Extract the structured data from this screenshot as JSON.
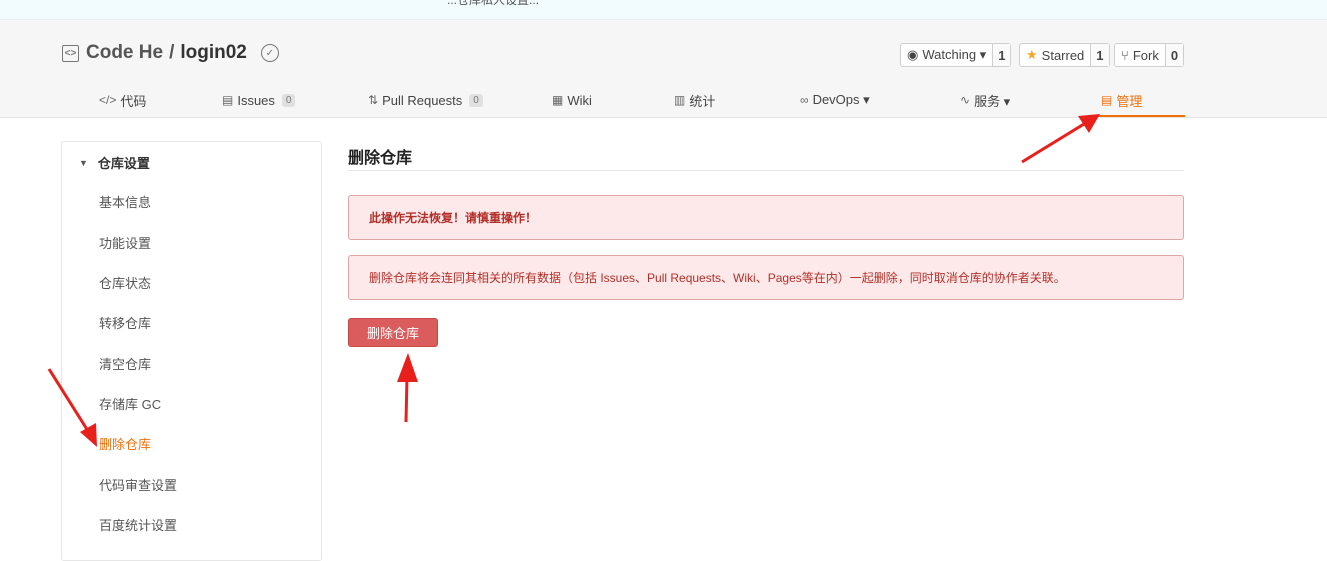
{
  "banner": {
    "text": "...仓库私人设置..."
  },
  "repo": {
    "owner": "Code He",
    "separator": "/",
    "name": "login02"
  },
  "header_actions": {
    "watch": {
      "label": "Watching ▾",
      "count": "1"
    },
    "star": {
      "label": "Starred",
      "count": "1"
    },
    "fork": {
      "label": "Fork",
      "count": "0"
    }
  },
  "tabs": [
    {
      "icon": "</>",
      "label": "代码"
    },
    {
      "icon": "▤",
      "label": "Issues",
      "count": "0"
    },
    {
      "icon": "⇅",
      "label": "Pull Requests",
      "count": "0"
    },
    {
      "icon": "▦",
      "label": "Wiki"
    },
    {
      "icon": "▥",
      "label": "统计"
    },
    {
      "icon": "∞",
      "label": "DevOps ▾"
    },
    {
      "icon": "∿",
      "label": "服务 ▾"
    },
    {
      "icon": "▤",
      "label": "管理"
    }
  ],
  "sidebar": {
    "section": "仓库设置",
    "items": [
      {
        "label": "基本信息"
      },
      {
        "label": "功能设置"
      },
      {
        "label": "仓库状态"
      },
      {
        "label": "转移仓库"
      },
      {
        "label": "清空仓库"
      },
      {
        "label": "存储库 GC"
      },
      {
        "label": "删除仓库"
      },
      {
        "label": "代码审查设置"
      },
      {
        "label": "百度统计设置"
      }
    ]
  },
  "main": {
    "title": "删除仓库",
    "warning": "此操作无法恢复！请慎重操作！",
    "description": "删除仓库将会连同其相关的所有数据（包括 Issues、Pull Requests、Wiki、Pages等在内）一起删除，同时取消仓库的协作者关联。",
    "delete_button": "删除仓库"
  },
  "colors": {
    "accent": "#f0700c",
    "danger": "#db5c5c",
    "arrow": "#e8201c"
  }
}
